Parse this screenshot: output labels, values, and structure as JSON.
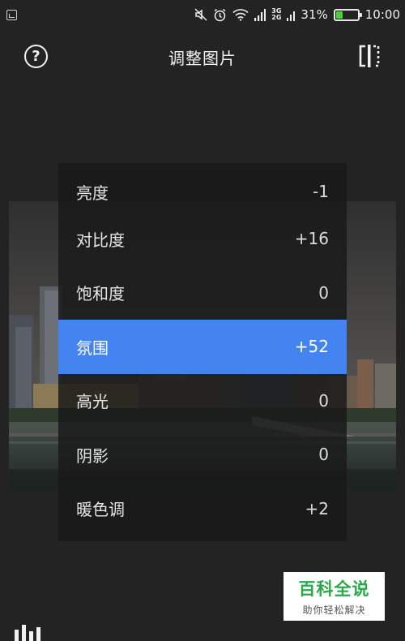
{
  "status_bar": {
    "app_icon": "gallery-notification-icon",
    "icons": [
      "mute-icon",
      "alarm-icon",
      "wifi-icon",
      "signal-icon"
    ],
    "network_top": "3G",
    "network_bottom": "2G",
    "battery_percent": "31%",
    "battery_level": 0.31,
    "time": "10:00"
  },
  "header": {
    "title": "调整图片",
    "help_symbol": "?",
    "compare_icon": "compare-split-icon"
  },
  "adjustments": {
    "items": [
      {
        "label": "亮度",
        "value": "-1"
      },
      {
        "label": "对比度",
        "value": "+16"
      },
      {
        "label": "饱和度",
        "value": "0"
      },
      {
        "label": "氛围",
        "value": "+52",
        "selected": true
      },
      {
        "label": "高光",
        "value": "0"
      },
      {
        "label": "阴影",
        "value": "0"
      },
      {
        "label": "暖色调",
        "value": "+2"
      }
    ]
  },
  "watermark": {
    "title": "百科全说",
    "subtitle": "助你轻松解决"
  },
  "colors": {
    "background": "#232323",
    "selected": "#4384f0",
    "battery": "#4ccf3a",
    "watermark_green": "#2aa84a"
  },
  "bottom_icon": "tools-bars-icon"
}
